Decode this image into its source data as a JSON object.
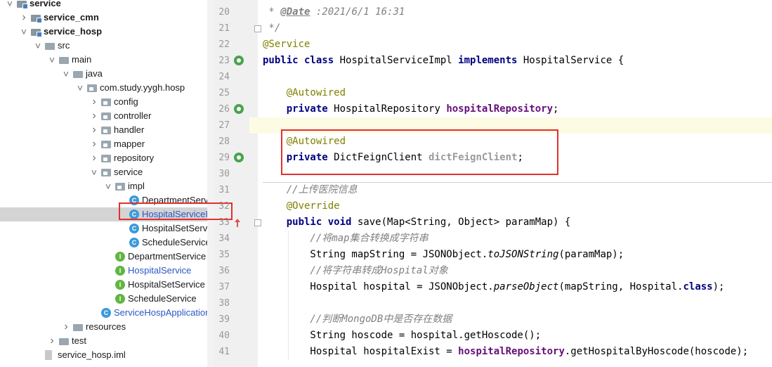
{
  "tree": {
    "items": [
      {
        "label": "service",
        "bold": true,
        "color": "dark",
        "icon": "folder-module-icon",
        "depth": 0,
        "arrow": "down"
      },
      {
        "label": "service_cmn",
        "bold": true,
        "color": "dark",
        "icon": "folder-module-icon",
        "depth": 1,
        "arrow": "right"
      },
      {
        "label": "service_hosp",
        "bold": true,
        "color": "dark",
        "icon": "folder-module-icon",
        "depth": 1,
        "arrow": "down"
      },
      {
        "label": "src",
        "bold": false,
        "color": "dark",
        "icon": "folder-icon",
        "depth": 2,
        "arrow": "down"
      },
      {
        "label": "main",
        "bold": false,
        "color": "dark",
        "icon": "folder-icon",
        "depth": 3,
        "arrow": "down"
      },
      {
        "label": "java",
        "bold": false,
        "color": "dark",
        "icon": "folder-icon",
        "depth": 4,
        "arrow": "down"
      },
      {
        "label": "com.study.yygh.hosp",
        "bold": false,
        "color": "dark",
        "icon": "package-icon",
        "depth": 5,
        "arrow": "down"
      },
      {
        "label": "config",
        "bold": false,
        "color": "dark",
        "icon": "package-icon",
        "depth": 6,
        "arrow": "right"
      },
      {
        "label": "controller",
        "bold": false,
        "color": "dark",
        "icon": "package-icon",
        "depth": 6,
        "arrow": "right"
      },
      {
        "label": "handler",
        "bold": false,
        "color": "dark",
        "icon": "package-icon",
        "depth": 6,
        "arrow": "right"
      },
      {
        "label": "mapper",
        "bold": false,
        "color": "dark",
        "icon": "package-icon",
        "depth": 6,
        "arrow": "right"
      },
      {
        "label": "repository",
        "bold": false,
        "color": "dark",
        "icon": "package-icon",
        "depth": 6,
        "arrow": "right"
      },
      {
        "label": "service",
        "bold": false,
        "color": "dark",
        "icon": "package-icon",
        "depth": 6,
        "arrow": "down"
      },
      {
        "label": "impl",
        "bold": false,
        "color": "dark",
        "icon": "package-icon",
        "depth": 7,
        "arrow": "down"
      },
      {
        "label": "DepartmentServic",
        "bold": false,
        "color": "dark",
        "icon": "class-icon",
        "depth": 8,
        "arrow": ""
      },
      {
        "label": "HospitalServiceIm",
        "bold": false,
        "color": "blue",
        "icon": "class-icon",
        "depth": 8,
        "arrow": "",
        "selected": true
      },
      {
        "label": "HospitalSetServic",
        "bold": false,
        "color": "dark",
        "icon": "class-icon",
        "depth": 8,
        "arrow": ""
      },
      {
        "label": "ScheduleServiceIr",
        "bold": false,
        "color": "dark",
        "icon": "class-icon",
        "depth": 8,
        "arrow": ""
      },
      {
        "label": "DepartmentService",
        "bold": false,
        "color": "dark",
        "icon": "interface-icon",
        "depth": 7,
        "arrow": ""
      },
      {
        "label": "HospitalService",
        "bold": false,
        "color": "blue",
        "icon": "interface-icon",
        "depth": 7,
        "arrow": ""
      },
      {
        "label": "HospitalSetService",
        "bold": false,
        "color": "dark",
        "icon": "interface-icon",
        "depth": 7,
        "arrow": ""
      },
      {
        "label": "ScheduleService",
        "bold": false,
        "color": "dark",
        "icon": "interface-icon",
        "depth": 7,
        "arrow": ""
      },
      {
        "label": "ServiceHospApplication",
        "bold": false,
        "color": "blue",
        "icon": "spring-class-icon",
        "depth": 6,
        "arrow": ""
      },
      {
        "label": "resources",
        "bold": false,
        "color": "dark",
        "icon": "folder-icon",
        "depth": 4,
        "arrow": "right"
      },
      {
        "label": "test",
        "bold": false,
        "color": "dark",
        "icon": "folder-icon",
        "depth": 3,
        "arrow": "right"
      },
      {
        "label": "service_hosp.iml",
        "bold": false,
        "color": "dark",
        "icon": "iml-file-icon",
        "depth": 2,
        "arrow": ""
      }
    ]
  },
  "editor": {
    "line_numbers": [
      "20",
      "21",
      "22",
      "23",
      "24",
      "25",
      "26",
      "27",
      "28",
      "29",
      "30",
      "31",
      "32",
      "33",
      "34",
      "35",
      "36",
      "37",
      "38",
      "39",
      "40",
      "41"
    ],
    "lines": [
      {
        "segs": [
          [
            " * ",
            "dt"
          ],
          [
            "@Date",
            "dttag"
          ],
          [
            " :2021/6/1 16:31",
            "dt"
          ]
        ]
      },
      {
        "segs": [
          [
            " */",
            "dt"
          ]
        ]
      },
      {
        "segs": [
          [
            "@Service",
            "ann"
          ]
        ]
      },
      {
        "segs": [
          [
            "public class ",
            "kw"
          ],
          [
            "HospitalServiceImpl ",
            ""
          ],
          [
            "implements ",
            "kw"
          ],
          [
            "HospitalService {",
            ""
          ]
        ]
      },
      {
        "segs": []
      },
      {
        "segs": [
          [
            "    @Autowired",
            "ann"
          ]
        ]
      },
      {
        "segs": [
          [
            "    private ",
            "kw"
          ],
          [
            "HospitalRepository ",
            ""
          ],
          [
            "hospitalRepository",
            "fld"
          ],
          [
            ";",
            ""
          ]
        ]
      },
      {
        "segs": [],
        "highlight": true
      },
      {
        "segs": [
          [
            "    @Autowired",
            "ann"
          ]
        ]
      },
      {
        "segs": [
          [
            "    private ",
            "kw"
          ],
          [
            "DictFeignClient ",
            ""
          ],
          [
            "dictFeignClient",
            "fldg"
          ],
          [
            ";",
            ""
          ]
        ]
      },
      {
        "segs": []
      },
      {
        "segs": [
          [
            "    //上传医院信息",
            "cmt"
          ]
        ]
      },
      {
        "segs": [
          [
            "    @Override",
            "ann"
          ]
        ]
      },
      {
        "segs": [
          [
            "    public void ",
            "kw"
          ],
          [
            "save(Map<String, Object> paramMap) {",
            ""
          ]
        ]
      },
      {
        "segs": [
          [
            "        //将map集合转换成字符串",
            "cmt"
          ]
        ]
      },
      {
        "segs": [
          [
            "        String mapString = JSONObject.",
            ""
          ],
          [
            "toJSONString",
            "it"
          ],
          [
            "(paramMap);",
            ""
          ]
        ]
      },
      {
        "segs": [
          [
            "        //将字符串转成Hospital对象",
            "cmt"
          ]
        ]
      },
      {
        "segs": [
          [
            "        Hospital hospital = JSONObject.",
            ""
          ],
          [
            "parseObject",
            "it"
          ],
          [
            "(mapString, Hospital.",
            ""
          ],
          [
            "class",
            "kw"
          ],
          [
            ");",
            ""
          ]
        ]
      },
      {
        "segs": []
      },
      {
        "segs": [
          [
            "        //判断MongoDB中是否存在数据",
            "cmt"
          ]
        ]
      },
      {
        "segs": [
          [
            "        String hoscode = hospital.getHoscode();",
            ""
          ]
        ]
      },
      {
        "segs": [
          [
            "        Hospital hospitalExist = ",
            ""
          ],
          [
            "hospitalRepository",
            "fld"
          ],
          [
            ".getHospitalByHoscode(hoscode);",
            ""
          ]
        ]
      }
    ]
  },
  "gutter_icons": [
    {
      "line": "23",
      "icon": "spring-bean-icon"
    },
    {
      "line": "26",
      "icon": "spring-bean-icon"
    },
    {
      "line": "29",
      "icon": "spring-bean-icon"
    },
    {
      "line": "33",
      "icon": "implements-method-icon"
    }
  ]
}
